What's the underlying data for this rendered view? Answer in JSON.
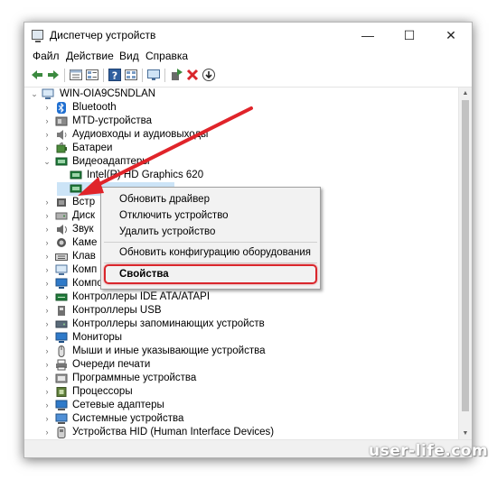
{
  "window": {
    "title": "Диспетчер устройств",
    "controls": {
      "minimize": "—",
      "maximize": "☐",
      "close": "✕"
    }
  },
  "menu": [
    "Файл",
    "Действие",
    "Вид",
    "Справка"
  ],
  "toolbar": {
    "icons": [
      "back-arrow-icon",
      "forward-arrow-icon",
      "properties-list-icon",
      "view-list-icon",
      "help-icon",
      "view-grid-icon",
      "monitor-icon",
      "update-driver-icon",
      "disable-device-red-x-icon",
      "download-circle-icon"
    ],
    "accent_colors": {
      "back_forward": "#3b8a3f",
      "disable": "#d9262c"
    }
  },
  "tree": {
    "root": "WIN-OIA9C5NDLAN",
    "items": [
      {
        "label": "Bluetooth",
        "icon": "bluetooth-icon",
        "expanded": false
      },
      {
        "label": "MTD-устройства",
        "icon": "mtd-device-icon",
        "expanded": false
      },
      {
        "label": "Аудиовходы и аудиовыходы",
        "icon": "speaker-icon",
        "expanded": false
      },
      {
        "label": "Батареи",
        "icon": "battery-icon",
        "expanded": false
      },
      {
        "label": "Видеоадаптеры",
        "icon": "display-adapter-icon",
        "expanded": true
      },
      {
        "label": "Intel(R) HD Graphics 620",
        "icon": "display-adapter-icon",
        "child": true
      },
      {
        "label": "",
        "icon": "display-adapter-icon",
        "child": true,
        "selected": true
      },
      {
        "label": "Встр",
        "icon": "chip-icon",
        "expanded": false
      },
      {
        "label": "Диск",
        "icon": "disk-icon",
        "expanded": false
      },
      {
        "label": "Звук",
        "icon": "sound-icon",
        "expanded": false
      },
      {
        "label": "Каме",
        "icon": "camera-icon",
        "expanded": false
      },
      {
        "label": "Клав",
        "icon": "keyboard-icon",
        "expanded": false
      },
      {
        "label": "Комп",
        "icon": "computer-icon",
        "expanded": false
      },
      {
        "label": "Компоненты",
        "icon": "monitor-icon",
        "expanded": false
      },
      {
        "label": "Контроллеры IDE ATA/ATAPI",
        "icon": "ide-controller-icon",
        "expanded": false
      },
      {
        "label": "Контроллеры USB",
        "icon": "usb-icon",
        "expanded": false
      },
      {
        "label": "Контроллеры запоминающих устройств",
        "icon": "storage-controller-icon",
        "expanded": false
      },
      {
        "label": "Мониторы",
        "icon": "monitor-icon",
        "expanded": false
      },
      {
        "label": "Мыши и иные указывающие устройства",
        "icon": "mouse-icon",
        "expanded": false
      },
      {
        "label": "Очереди печати",
        "icon": "printer-icon",
        "expanded": false
      },
      {
        "label": "Программные устройства",
        "icon": "software-device-icon",
        "expanded": false
      },
      {
        "label": "Процессоры",
        "icon": "processor-icon",
        "expanded": false
      },
      {
        "label": "Сетевые адаптеры",
        "icon": "network-adapter-icon",
        "expanded": false
      },
      {
        "label": "Системные устройства",
        "icon": "system-device-icon",
        "expanded": false
      },
      {
        "label": "Устройства HID (Human Interface Devices)",
        "icon": "hid-icon",
        "expanded": false
      }
    ]
  },
  "context_menu": {
    "items": [
      "Обновить драйвер",
      "Отключить устройство",
      "Удалить устройство",
      "Обновить конфигурацию оборудования",
      "Свойства"
    ],
    "highlighted": "Свойства",
    "highlight_color": "#d9262c"
  },
  "annotation": {
    "arrow_color": "#e0242a"
  },
  "watermark": "user-life.com"
}
